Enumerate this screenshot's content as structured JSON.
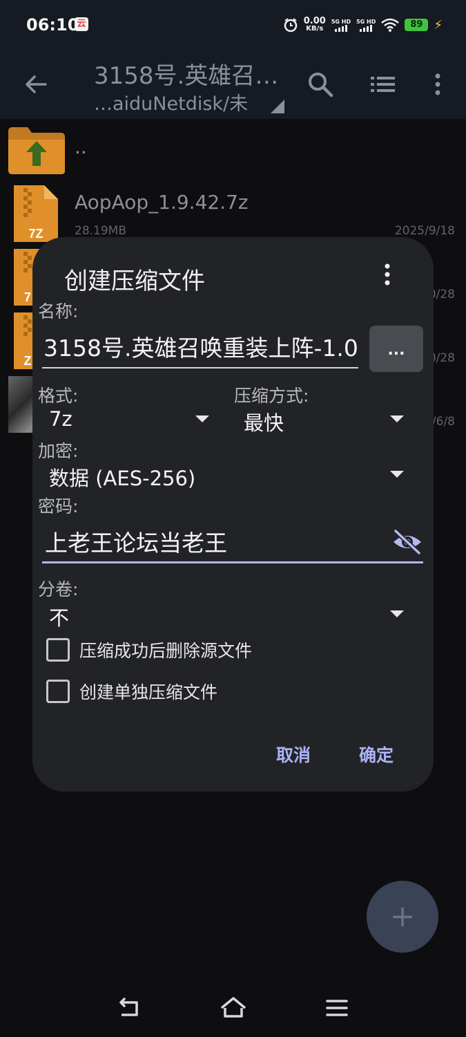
{
  "status_bar": {
    "time": "06:10",
    "app_badge": "云",
    "speed_value": "0.00",
    "speed_unit": "KB/s",
    "sim1": "5G HD",
    "sim2": "5G HD",
    "battery": "89"
  },
  "toolbar": {
    "title": "3158号.英雄召…",
    "path": "…aiduNetdisk/未"
  },
  "files": [
    {
      "name": "..",
      "type": "parent"
    },
    {
      "name": "AopAop_1.9.42.7z",
      "size": "28.19MB",
      "date": "2025/9/18",
      "type": "7z",
      "icon_label": "7Z"
    },
    {
      "name": "",
      "size": "",
      "date": "0/28",
      "type": "7z",
      "icon_label": "7"
    },
    {
      "name": "",
      "size": "",
      "date": "0/28",
      "type": "7z",
      "icon_label": "Z"
    },
    {
      "name": "",
      "size": "",
      "date": "/6/8",
      "type": "image"
    }
  ],
  "dialog": {
    "title": "创建压缩文件",
    "name_label": "名称:",
    "name_value": "3158号.英雄召唤重装上阵-1.0.",
    "browse_label": "...",
    "format_label": "格式:",
    "format_value": "7z",
    "compression_label": "压缩方式:",
    "compression_value": "最快",
    "encryption_label": "加密:",
    "encryption_value": "数据 (AES-256)",
    "password_label": "密码:",
    "password_value": "上老王论坛当老王",
    "split_label": "分卷:",
    "split_value": "不",
    "delete_source_label": "压缩成功后删除源文件",
    "separate_archive_label": "创建单独压缩文件",
    "cancel_label": "取消",
    "ok_label": "确定"
  },
  "fab": {
    "label": "+"
  },
  "colors": {
    "accent": "#aab4f4",
    "dialog_bg": "#222327",
    "toolbar_bg": "#161a22",
    "archive_orange": "#e0902a"
  }
}
